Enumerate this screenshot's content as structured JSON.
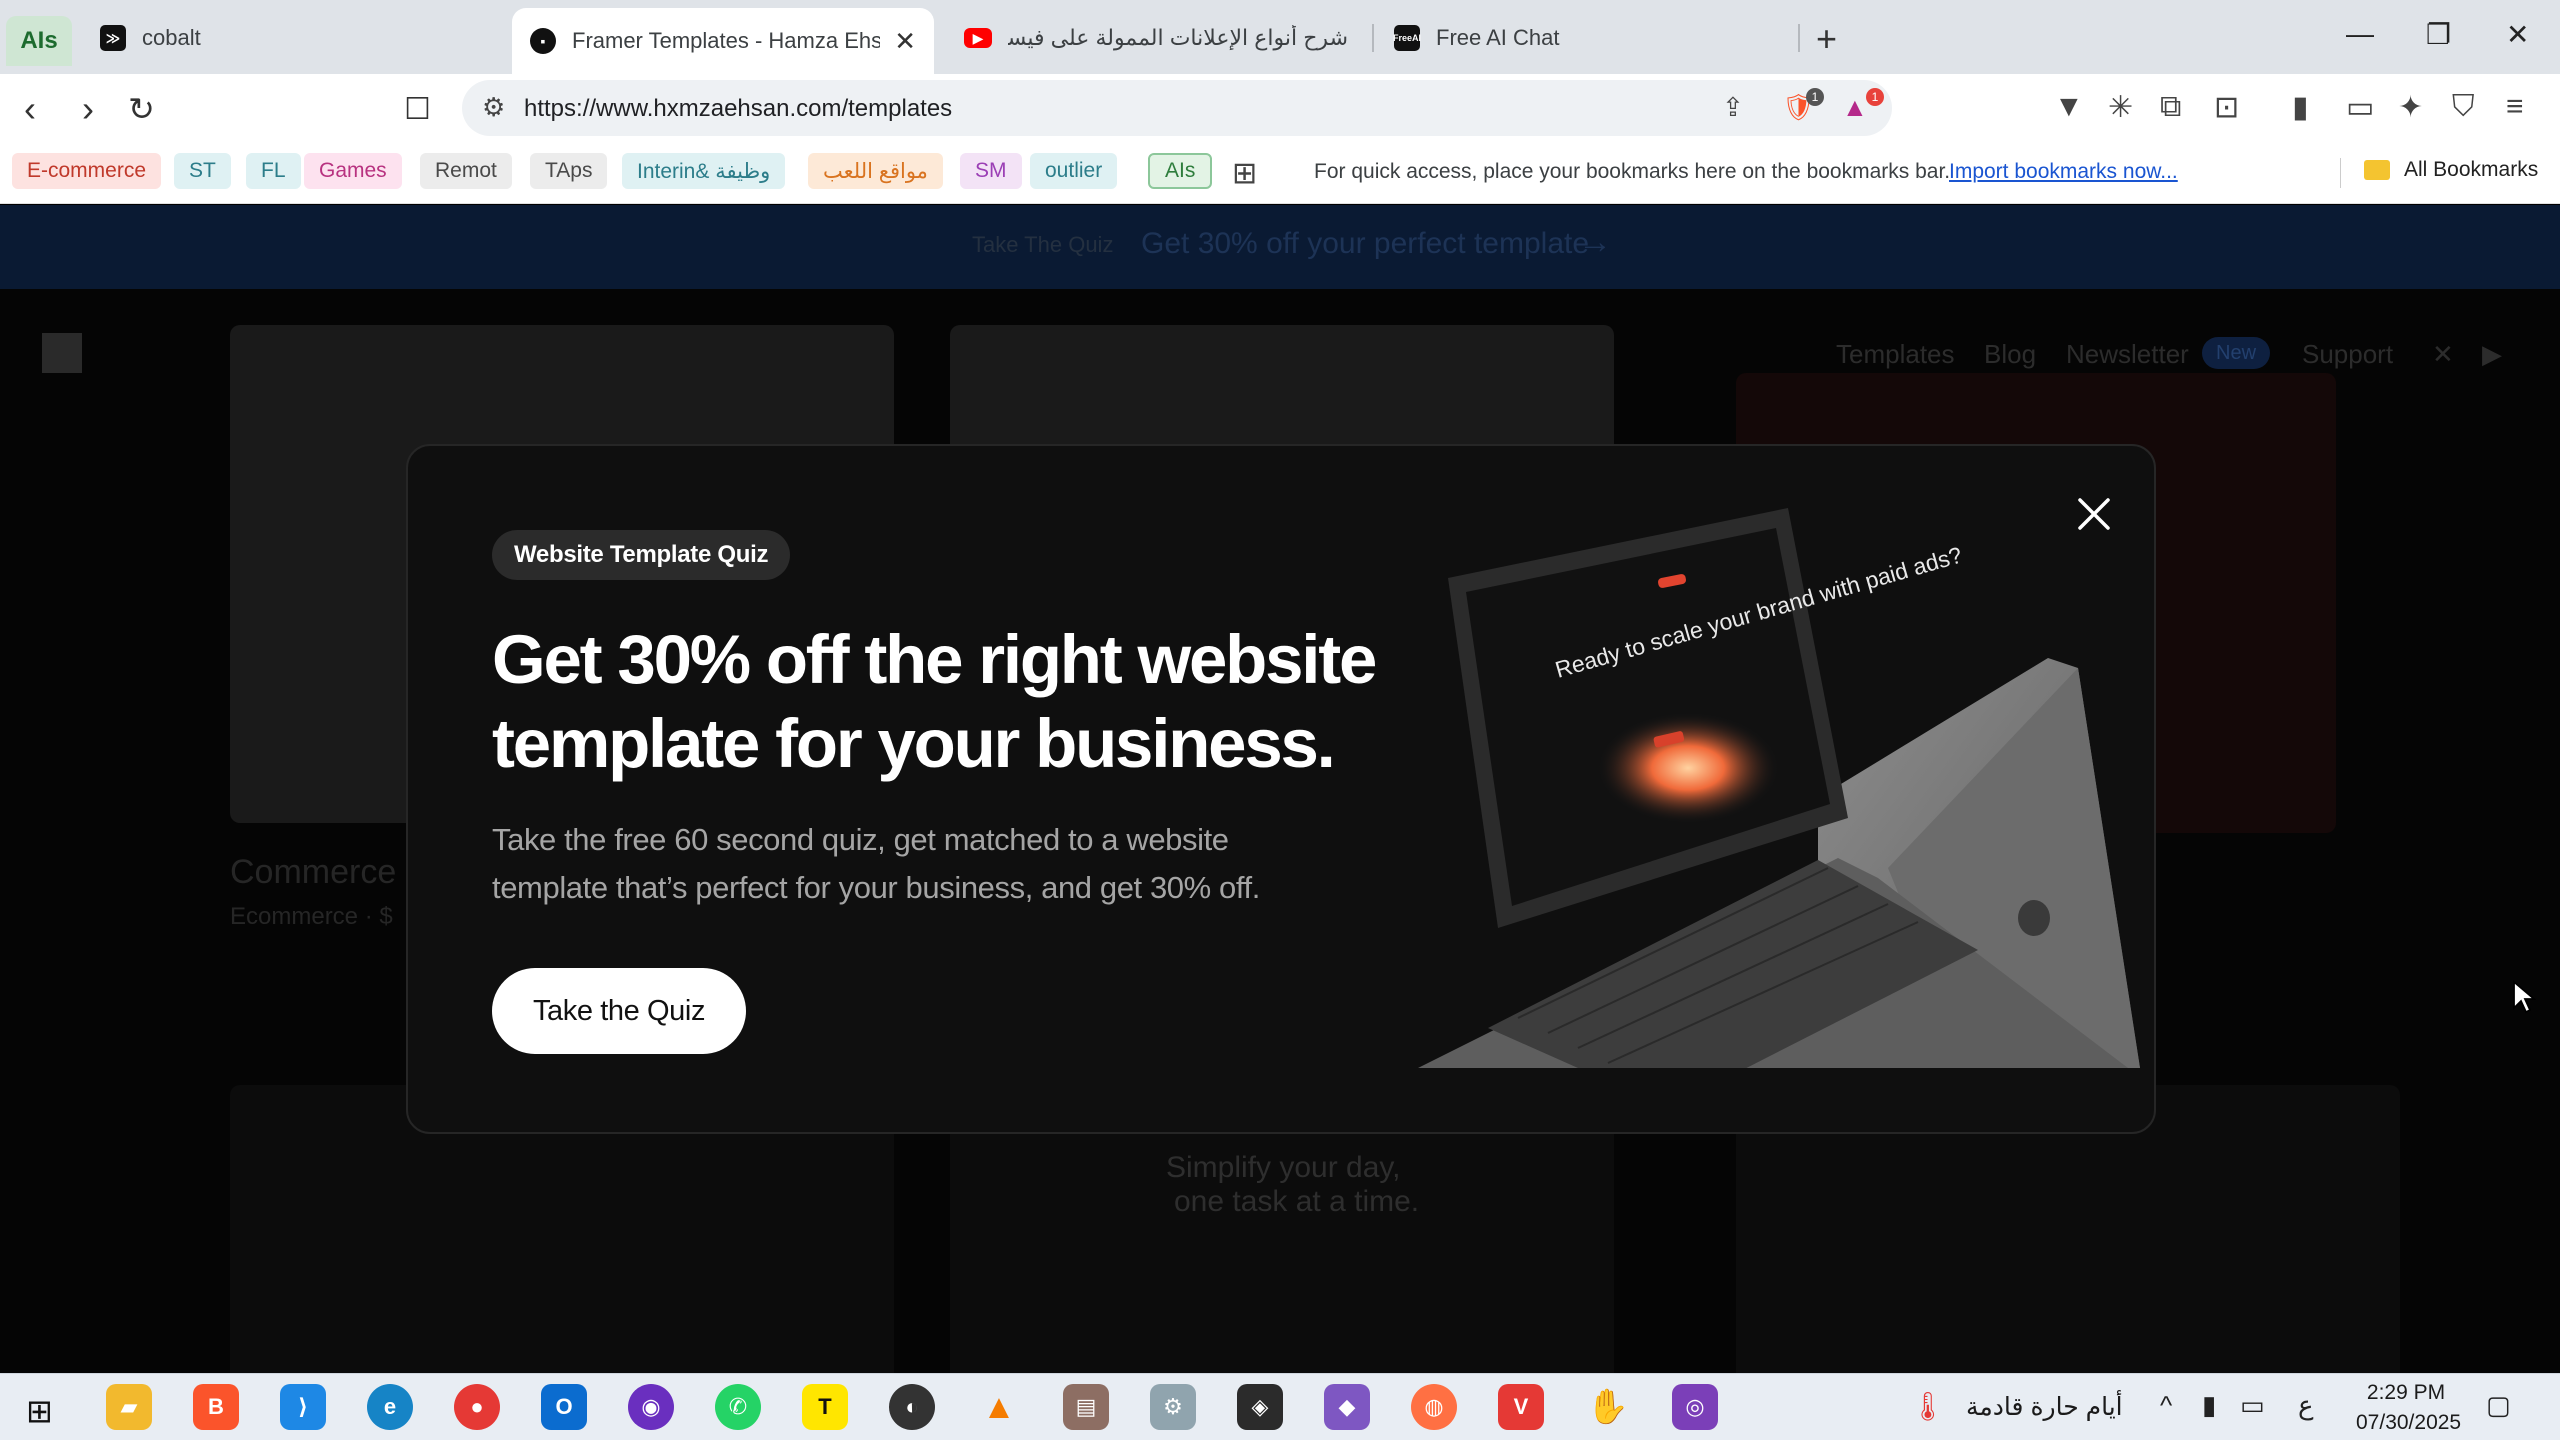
{
  "browser": {
    "tab_group_label": "AIs",
    "tabs": [
      {
        "title": "cobalt",
        "icon": "cobalt-icon"
      },
      {
        "title": "Framer Templates - Hamza Ehsan",
        "icon": "framer-icon",
        "active": true
      },
      {
        "title": "شرح أنواع الإعلانات الممولة على فيسبوك",
        "icon": "youtube-icon"
      },
      {
        "title": "Free AI Chat",
        "icon": "freeai-icon"
      }
    ],
    "url": "https://www.hxmzaehsan.com/templates",
    "brave_shield_count": "1",
    "rewards_count": "1"
  },
  "bookmarks": {
    "chips": [
      {
        "label": "E-commerce",
        "bg": "#fde2e0",
        "fg": "#c0392b"
      },
      {
        "label": "ST",
        "bg": "#dff1f3",
        "fg": "#2c7d8a"
      },
      {
        "label": "FL",
        "bg": "#dff1f3",
        "fg": "#2c7d8a"
      },
      {
        "label": "Games",
        "bg": "#fde2ef",
        "fg": "#b83280"
      },
      {
        "label": "Remot",
        "bg": "#ececec",
        "fg": "#4a4a4a"
      },
      {
        "label": "TAps",
        "bg": "#ececec",
        "fg": "#4a4a4a"
      },
      {
        "label": "Interin& وظيفة",
        "bg": "#dff1f3",
        "fg": "#2c7d8a"
      },
      {
        "label": "مواقع اللعب",
        "bg": "#fde9d7",
        "fg": "#d9731f"
      },
      {
        "label": "SM",
        "bg": "#f3e3f6",
        "fg": "#9b3fb5"
      },
      {
        "label": "outlier",
        "bg": "#dff1f3",
        "fg": "#2c7d8a"
      },
      {
        "label": "AIs",
        "bg": "#e3f3e5",
        "fg": "#2e7d3c"
      }
    ],
    "hint": "For quick access, place your bookmarks here on the bookmarks bar.",
    "import_link": "Import bookmarks now...",
    "all_bookmarks": "All Bookmarks"
  },
  "page": {
    "promo_small": "Take The Quiz",
    "promo_big": "Get 30% off your perfect template",
    "nav": [
      "Templates",
      "Blog",
      "Newsletter",
      "Support"
    ],
    "nav_badge": "New",
    "card_title": "Commerce",
    "card_subtitle": "Ecommerce · $",
    "bg_headline_1": "Simplify your day,",
    "bg_headline_2": "one task at a time."
  },
  "modal": {
    "badge": "Website Template Quiz",
    "headline": "Get 30% off the right website template for your business.",
    "subtext": "Take the free 60 second quiz, get matched to a website template that’s perfect for your business, and get 30% off.",
    "cta": "Take the Quiz",
    "laptop_screen_text": "Ready to scale your brand with paid ads?"
  },
  "taskbar": {
    "weather": "أيام حارة قادمة",
    "lang": "ع",
    "time": "2:29 PM",
    "date": "07/30/2025"
  }
}
